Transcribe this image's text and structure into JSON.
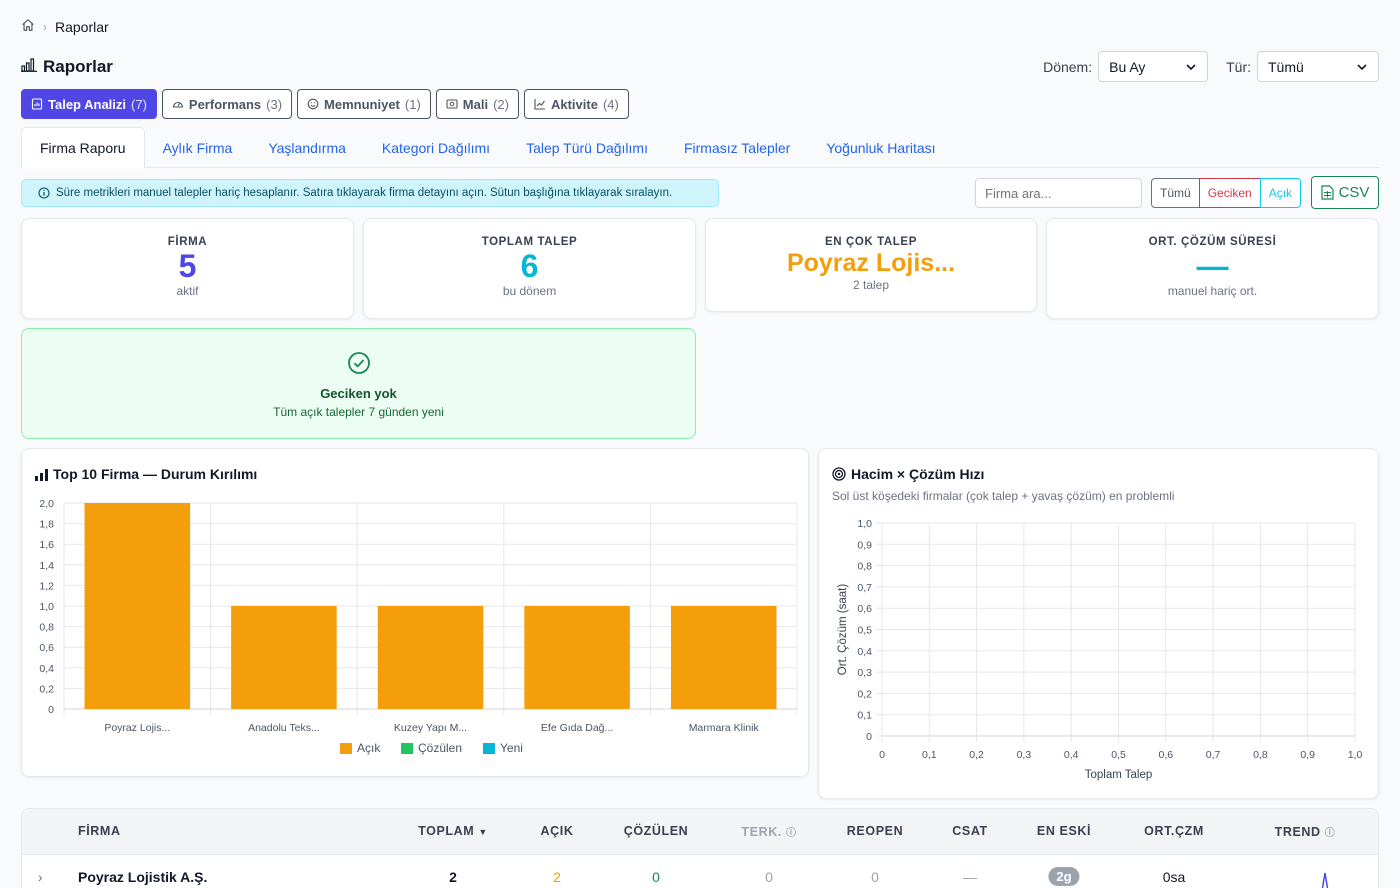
{
  "breadcrumb": {
    "home_icon": "home-icon",
    "current": "Raporlar"
  },
  "page": {
    "title": "Raporlar"
  },
  "filters": {
    "period_label": "Dönem:",
    "period_value": "Bu Ay",
    "type_label": "Tür:",
    "type_value": "Tümü"
  },
  "report_tabs": [
    {
      "label": "Talep Analizi",
      "count": "(7)",
      "icon": "report-icon"
    },
    {
      "label": "Performans",
      "count": "(3)",
      "icon": "speedometer-icon"
    },
    {
      "label": "Memnuniyet",
      "count": "(1)",
      "icon": "smiley-icon"
    },
    {
      "label": "Mali",
      "count": "(2)",
      "icon": "money-icon"
    },
    {
      "label": "Aktivite",
      "count": "(4)",
      "icon": "trend-icon"
    }
  ],
  "sub_tabs": [
    "Firma Raporu",
    "Aylık Firma",
    "Yaşlandırma",
    "Kategori Dağılımı",
    "Talep Türü Dağılımı",
    "Firmasız Talepler",
    "Yoğunluk Haritası"
  ],
  "info_text": "Süre metrikleri manuel talepler hariç hesaplanır. Satıra tıklayarak firma detayını açın. Sütun başlığına tıklayarak sıralayın.",
  "search": {
    "placeholder": "Firma ara..."
  },
  "status_filter": {
    "all": "Tümü",
    "late": "Geciken",
    "open": "Açık"
  },
  "csv_label": "CSV",
  "stats": {
    "firma": {
      "label": "FİRMA",
      "value": "5",
      "sub": "aktif"
    },
    "toplam": {
      "label": "TOPLAM TALEP",
      "value": "6",
      "sub": "bu dönem"
    },
    "en_cok": {
      "label": "EN ÇOK TALEP",
      "value": "Poyraz Lojis...",
      "sub": "2 talep"
    },
    "ort": {
      "label": "ORT. ÇÖZÜM SÜRESİ",
      "value": "—",
      "sub": "manuel hariç ort."
    }
  },
  "geciken": {
    "title": "Geciken yok",
    "sub": "Tüm açık talepler 7 günden yeni"
  },
  "colors": {
    "acik": "#f59e0b",
    "cozulen": "#22c55e",
    "yeni": "#06b6d4",
    "accent": "#4f46e5",
    "teal": "#06b6d4"
  },
  "chart_data": [
    {
      "type": "bar",
      "title": "Top 10 Firma — Durum Kırılımı",
      "categories": [
        "Poyraz Lojis...",
        "Anadolu Teks...",
        "Kuzey Yapı M...",
        "Efe Gıda Dağ...",
        "Marmara Klinik"
      ],
      "series": [
        {
          "name": "Açık",
          "values": [
            2,
            1,
            1,
            1,
            1
          ]
        },
        {
          "name": "Çözülen",
          "values": [
            0,
            0,
            0,
            0,
            0
          ]
        },
        {
          "name": "Yeni",
          "values": [
            0,
            0,
            0,
            0,
            0
          ]
        }
      ],
      "stacked": true,
      "ylim": [
        0,
        2
      ],
      "yticks": [
        "0",
        "0,2",
        "0,4",
        "0,6",
        "0,8",
        "1,0",
        "1,2",
        "1,4",
        "1,6",
        "1,8",
        "2,0"
      ],
      "legend": "bottom"
    },
    {
      "type": "scatter",
      "title": "Hacim × Çözüm Hızı",
      "subtitle": "Sol üst köşedeki firmalar (çok talep + yavaş çözüm) en problemli",
      "xlabel": "Toplam Talep",
      "ylabel": "Ort. Çözüm (saat)",
      "xlim": [
        0,
        1
      ],
      "ylim": [
        0,
        1
      ],
      "xticks": [
        "0",
        "0,1",
        "0,2",
        "0,3",
        "0,4",
        "0,5",
        "0,6",
        "0,7",
        "0,8",
        "0,9",
        "1,0"
      ],
      "yticks": [
        "0",
        "0,1",
        "0,2",
        "0,3",
        "0,4",
        "0,5",
        "0,6",
        "0,7",
        "0,8",
        "0,9",
        "1,0"
      ],
      "points": []
    }
  ],
  "table": {
    "headers": {
      "firma": "FİRMA",
      "toplam": "TOPLAM",
      "acik": "AÇIK",
      "cozulen": "ÇÖZÜLEN",
      "terk": "TERK.",
      "reopen": "REOPEN",
      "csat": "CSAT",
      "en_eski": "EN ESKİ",
      "ort": "ORT.ÇZM",
      "trend": "TREND"
    },
    "rows": [
      {
        "firma": "Poyraz Lojistik A.Ş.",
        "toplam": "2",
        "acik": "2",
        "cozulen": "0",
        "terk": "0",
        "reopen": "0",
        "csat": "—",
        "en_eski": "2g",
        "ort": "0sa"
      }
    ]
  }
}
